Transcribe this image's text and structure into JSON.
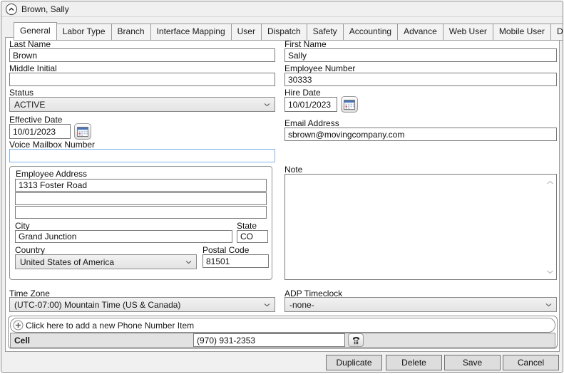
{
  "window": {
    "title": "Brown, Sally"
  },
  "tabs": [
    {
      "label": "General",
      "active": true
    },
    {
      "label": "Labor Type",
      "active": false
    },
    {
      "label": "Branch",
      "active": false
    },
    {
      "label": "Interface Mapping",
      "active": false
    },
    {
      "label": "User",
      "active": false
    },
    {
      "label": "Dispatch",
      "active": false
    },
    {
      "label": "Safety",
      "active": false
    },
    {
      "label": "Accounting",
      "active": false
    },
    {
      "label": "Advance",
      "active": false
    },
    {
      "label": "Web User",
      "active": false
    },
    {
      "label": "Mobile User",
      "active": false
    },
    {
      "label": "Documents",
      "active": false
    }
  ],
  "fields": {
    "last_name": {
      "label": "Last Name",
      "value": "Brown"
    },
    "first_name": {
      "label": "First Name",
      "value": "Sally"
    },
    "middle_initial": {
      "label": "Middle Initial",
      "value": ""
    },
    "employee_number": {
      "label": "Employee Number",
      "value": "30333"
    },
    "status": {
      "label": "Status",
      "value": "ACTIVE"
    },
    "hire_date": {
      "label": "Hire Date",
      "value": "10/01/2023"
    },
    "effective_date": {
      "label": "Effective Date",
      "value": "10/01/2023"
    },
    "email": {
      "label": "Email Address",
      "value": "sbrown@movingcompany.com"
    },
    "voice_mailbox": {
      "label": "Voice Mailbox Number",
      "value": ""
    },
    "note": {
      "label": "Note",
      "value": ""
    },
    "time_zone": {
      "label": "Time Zone",
      "value": "(UTC-07:00) Mountain Time (US & Canada)"
    },
    "adp_timeclock": {
      "label": "ADP Timeclock",
      "value": "-none-"
    }
  },
  "address": {
    "group_label": "Employee Address",
    "line1": "1313 Foster Road",
    "line2": "",
    "line3": "",
    "city": {
      "label": "City",
      "value": "Grand Junction"
    },
    "state": {
      "label": "State",
      "value": "CO"
    },
    "country": {
      "label": "Country",
      "value": "United States of America"
    },
    "postal_code": {
      "label": "Postal Code",
      "value": "81501"
    }
  },
  "phone": {
    "add_label": "Click here to add a new Phone Number Item",
    "items": [
      {
        "type": "Cell",
        "number": "(970) 931-2353"
      }
    ]
  },
  "footer": {
    "duplicate": "Duplicate",
    "delete": "Delete",
    "save": "Save",
    "cancel": "Cancel"
  },
  "colors": {
    "focus_border": "#7eb4ea",
    "combo_bg": "#e8e8e8",
    "phone_row_bg": "#e2e2e2",
    "calendar_header_blue": "#4a76b8",
    "calendar_highlight_red": "#e04b3c"
  }
}
